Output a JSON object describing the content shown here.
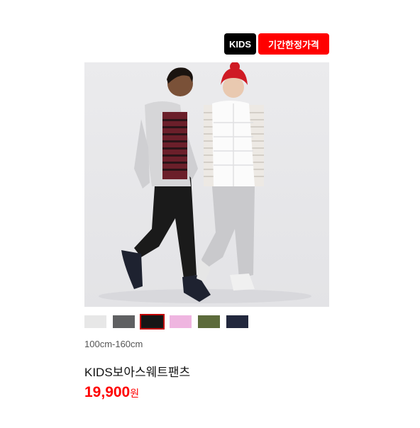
{
  "badges": {
    "kids": "KIDS",
    "sale": "기간한정가격"
  },
  "product": {
    "image_alt": "Two kids wearing sweatpants",
    "colors": [
      {
        "name": "light-gray",
        "hex": "#e7e7e7"
      },
      {
        "name": "dark-gray",
        "hex": "#5f6062"
      },
      {
        "name": "black",
        "hex": "#151515",
        "selected": true
      },
      {
        "name": "pink",
        "hex": "#efb5e0"
      },
      {
        "name": "olive",
        "hex": "#5c6b3b"
      },
      {
        "name": "navy",
        "hex": "#22283d"
      }
    ],
    "size_range": "100cm-160cm",
    "name": "KIDS보아스웨트팬츠",
    "price": "19,900",
    "currency": "원"
  }
}
